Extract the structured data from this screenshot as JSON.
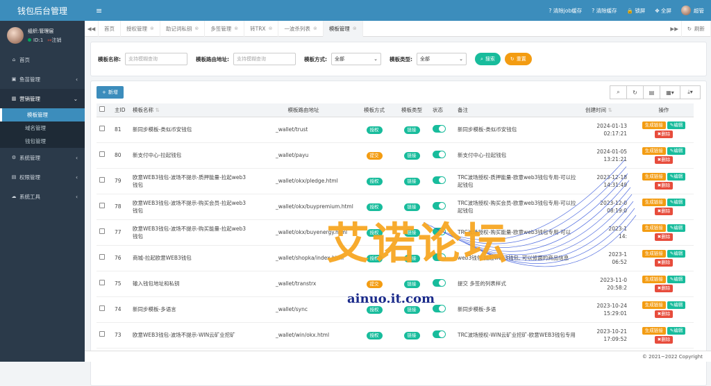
{
  "sidebar": {
    "app_title": "钱包后台管理",
    "user": {
      "name": "组织:管理层",
      "id_text": "ID:1",
      "logout": "注销"
    },
    "menu": [
      {
        "icon": "home-icon",
        "label": "首页"
      },
      {
        "icon": "fishing-icon",
        "label": "鱼苗管理",
        "arrow": "‹"
      },
      {
        "icon": "bank-icon",
        "label": "营销管理",
        "arrow": "⌄",
        "open": true,
        "children": [
          {
            "label": "模板管理",
            "active": true
          },
          {
            "label": "域名管理"
          },
          {
            "label": "钱包管理"
          }
        ]
      },
      {
        "icon": "gear-icon",
        "label": "系统管理",
        "arrow": "‹"
      },
      {
        "icon": "id-card-icon",
        "label": "权限管理",
        "arrow": "‹"
      },
      {
        "icon": "cloud-icon",
        "label": "系统工具",
        "arrow": "‹"
      }
    ]
  },
  "header": {
    "menu_toggle": "≡",
    "clear_job_cache": "清除job缓存",
    "clear_cache": "清除缓存",
    "lock_screen": "锁屏",
    "fullscreen": "全屏",
    "username": "超管"
  },
  "tabs": {
    "items": [
      "首页",
      "授权管理",
      "助记词私钥",
      "多签管理",
      "转TRX",
      "一波杀列表",
      "模板管理"
    ],
    "active_index": 6,
    "refresh": "刷新"
  },
  "filter": {
    "name_label": "模板名称:",
    "name_placeholder": "支持模糊查询",
    "route_label": "模板路由地址:",
    "route_placeholder": "支持模糊查询",
    "method_label": "模板方式:",
    "method_value": "全部",
    "type_label": "模板类型:",
    "type_value": "全部",
    "search_btn": "搜索",
    "reset_btn": "重置"
  },
  "toolbar": {
    "add_btn": "新增"
  },
  "table": {
    "headers": {
      "id": "主ID",
      "name": "模板名称",
      "route": "模板路由地址",
      "method": "模板方式",
      "type": "模板类型",
      "status": "状态",
      "remark": "备注",
      "created": "创建时间",
      "ops": "操作"
    },
    "ops_labels": {
      "gen": "生成链接",
      "edit": "编辑",
      "del": "删除"
    },
    "rows": [
      {
        "id": "81",
        "name": "新同步模板-类似币安钱包",
        "route": "_wallet/trust",
        "method": "授权",
        "type": "链接",
        "remark": "新同步模板-类似币安钱包",
        "date": "2024-01-13",
        "time": "02:17:21"
      },
      {
        "id": "80",
        "name": "新支付中心-拉起钱包",
        "route": "_wallet/payu",
        "method": "提交",
        "type": "链接",
        "remark": "新支付中心-拉起钱包",
        "date": "2024-01-05",
        "time": "13:21:21"
      },
      {
        "id": "79",
        "name": "欧意WEB3钱包-波场不提示-质押能量-拉起web3钱包",
        "route": "_wallet/okx/pledge.html",
        "method": "授权",
        "type": "链接",
        "remark": "TRC波场授权-质押能量-欧意web3钱包专用-可以拉起钱包",
        "date": "2023-12-18",
        "time": "14:31:49"
      },
      {
        "id": "78",
        "name": "欧意WEB3钱包-波场不提示-购买会员-拉起web3钱包",
        "route": "_wallet/okx/buypremium.html",
        "method": "授权",
        "type": "链接",
        "remark": "TRC波场授权-购买会员-欧意web3钱包专用-可以拉起钱包",
        "date": "2023-12-0",
        "time": "08:19:0"
      },
      {
        "id": "77",
        "name": "欧意WEB3钱包-波场不提示-购买能量-拉起web3钱包",
        "route": "_wallet/okx/buyenergy.html",
        "method": "授权",
        "type": "链接",
        "remark": "TRC波场授权-购买能量-欧意web3钱包专用-可以",
        "date": "2023-1",
        "time": "14:"
      },
      {
        "id": "76",
        "name": "商城-拉起欧意WEB3钱包",
        "route": "_wallet/shopka/index.html",
        "method": "授权",
        "type": "链接",
        "remark": "web3钱包 拉起web3钱包, 可以修面的商品信息",
        "date": "2023-1",
        "time": "06:52"
      },
      {
        "id": "75",
        "name": "输入钱包地址和私钥",
        "route": "_wallet/transtrx",
        "method": "提交",
        "type": "链接",
        "remark": "提交 多签的列表样式",
        "date": "2023-11-0",
        "time": "20:58:2"
      },
      {
        "id": "74",
        "name": "新同步模板-多语言",
        "route": "_wallet/sync",
        "method": "授权",
        "type": "链接",
        "remark": "新同步模板-多语",
        "date": "2023-10-24",
        "time": "15:29:01"
      },
      {
        "id": "73",
        "name": "欧意WEB3钱包-波场不提示-WIN云矿业挖矿",
        "route": "_wallet/win/okx.html",
        "method": "授权",
        "type": "链接",
        "remark": "TRC波场授权-WIN云矿业挖矿-欧意WEB3钱包专用",
        "date": "2023-10-21",
        "time": "17:09:52"
      }
    ]
  },
  "footer": {
    "copyright": "© 2021~2022 Copyright"
  },
  "watermark": {
    "text": "艾诺论坛",
    "url": "ainuo.it.com"
  }
}
